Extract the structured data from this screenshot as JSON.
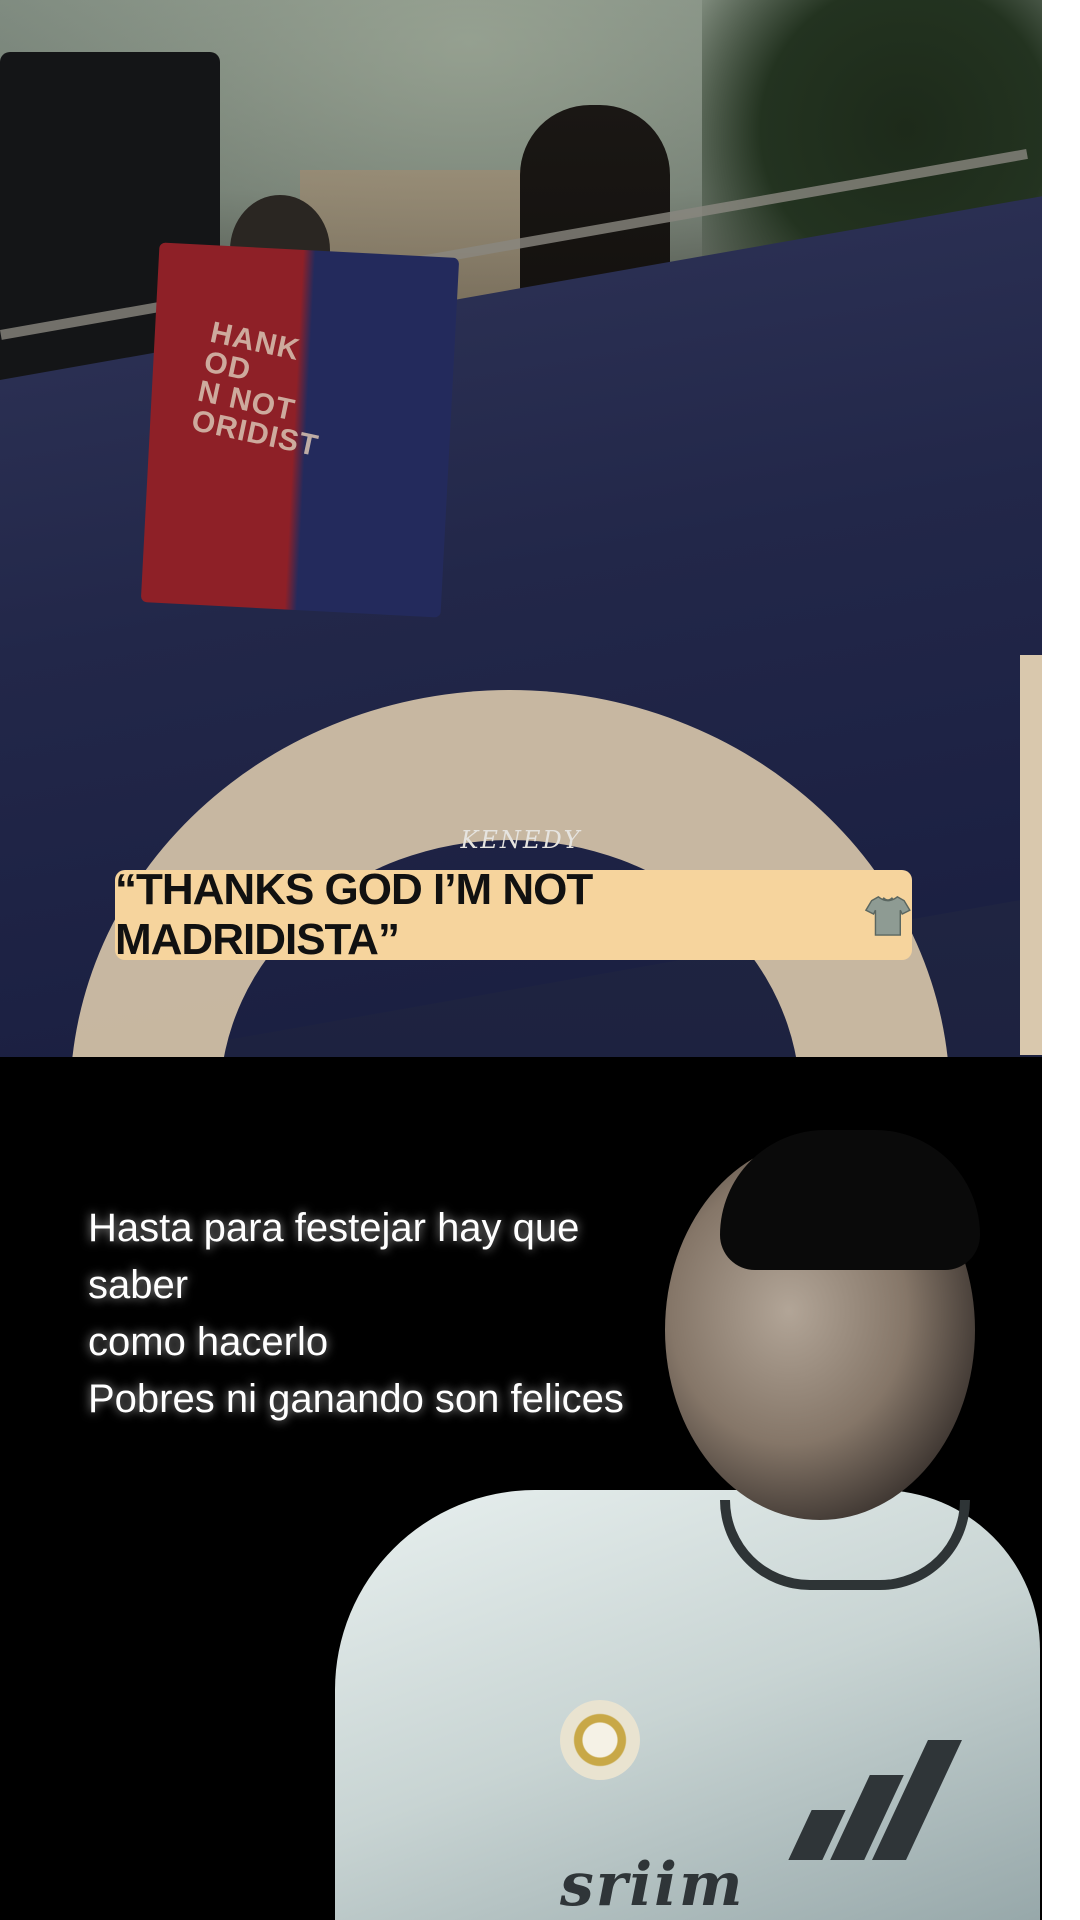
{
  "top_video": {
    "watermark": "KENEDY",
    "caption": "“THANKS GOD I’M NOT MADRIDISTA”",
    "caption_icon": "shirt-icon",
    "flag_text": "HANK\nOD\nN NOT\nORIDIST"
  },
  "bottom_video": {
    "overlay_lines": [
      "Hasta para festejar hay que saber",
      "como hacerlo",
      "Pobres ni ganando son felices"
    ],
    "jersey_text": "sriim"
  },
  "colors": {
    "caption_bg": "#f6d49d",
    "flag_red": "#8e2027",
    "flag_blue": "#232a5c",
    "jersey": "#e8f0ef"
  }
}
